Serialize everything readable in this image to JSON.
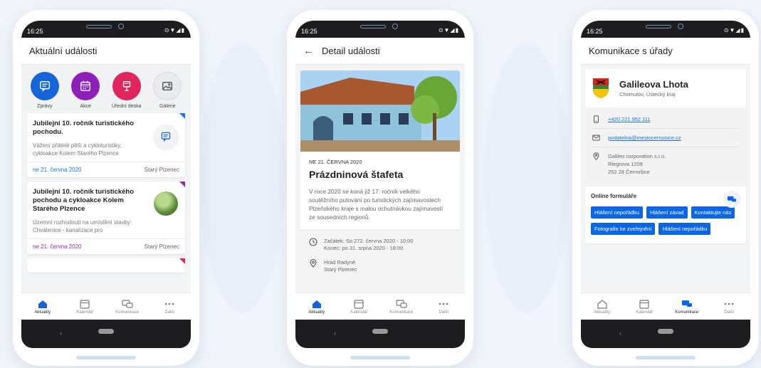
{
  "status_time": "16:25",
  "status_icons": "⊙▼◢▮",
  "tabs": [
    {
      "label": "Aktuality"
    },
    {
      "label": "Kalendář"
    },
    {
      "label": "Komunikace"
    },
    {
      "label": "Další"
    }
  ],
  "screen1": {
    "title": "Aktuální události",
    "quick": [
      {
        "label": "Zprávy",
        "color": "#1565d8",
        "icon": "message-icon"
      },
      {
        "label": "Akce",
        "color": "#8e1fb8",
        "icon": "calendar-icon"
      },
      {
        "label": "Úřední deska",
        "color": "#e0245e",
        "icon": "noticeboard-icon"
      },
      {
        "label": "Galerie",
        "color": "#e9ebee",
        "icon": "gallery-icon"
      }
    ],
    "cards": [
      {
        "title": "Jubilejní 10. ročník turistického pochodu.",
        "desc": "Vážení přátelé pěší a cykloturistiky, cykloakce Kolem Starého Plzence",
        "date": "ne 21. června 2020",
        "place": "Starý Plzenec",
        "accent": "#1a73e8"
      },
      {
        "title": "Jubilejní 10. ročník turistického pochodu a cykloakce Kolem Starého Plzence",
        "desc": "Územní rozhodnutí na umístění stavby: Chválenice - kanalizace pro",
        "date": "ne 21. června 2020",
        "place": "Starý Plzenec",
        "accent": "#9c27b0"
      }
    ]
  },
  "screen2": {
    "title": "Detail události",
    "date": "NE 21. ČERVNA 2020",
    "event_title": "Prázdninová štafeta",
    "text": "V roce 2020 se koná již 17. ročník velkého soutěžního putování po turistických zajímavostech Plzeňského kraje s malou ochutnávkou zajímavostí ze sousedních regionů.",
    "start": "Začátek: So 272. června 2020 - 10:00",
    "end": "Konec: po 31. srpna 2020 - 18:00",
    "place_line1": "Hrad Radyně",
    "place_line2": "Starý Plzenec"
  },
  "screen3": {
    "title": "Komunikace s úřady",
    "office_name": "Galileova Lhota",
    "office_region": "Chomutov, Ústecký kraj",
    "phone": "+420 221 952 111",
    "email": "podatelna@mestocernosice.cz",
    "address1": "Galileo corporation s.r.o.",
    "address2": "Riegrova 1209",
    "address3": "252 28 Černošice",
    "forms_label": "Online formuláře",
    "chips": [
      "Hlášení nepořádku",
      "Hlášení závad",
      "Kontaktujte nás",
      "Fotografie ke zveřejnění",
      "Hlášení nepořádku"
    ]
  }
}
